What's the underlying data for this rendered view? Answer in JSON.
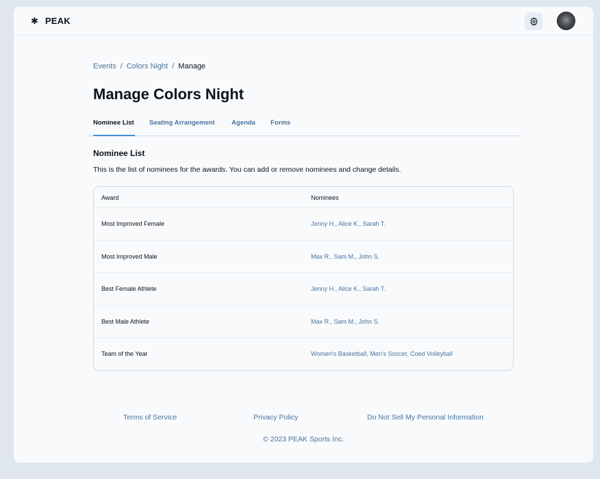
{
  "header": {
    "logo_icon": "✱",
    "brand": "PEAK",
    "settings_icon": "gear-icon",
    "avatar": "user-avatar"
  },
  "breadcrumb": {
    "items": [
      "Events",
      "Colors Night"
    ],
    "separator": "/",
    "current": "Manage"
  },
  "page": {
    "title": "Manage Colors Night"
  },
  "tabs": [
    {
      "label": "Nominee List",
      "active": true
    },
    {
      "label": "Seating Arrangement",
      "active": false
    },
    {
      "label": "Agenda",
      "active": false
    },
    {
      "label": "Forms",
      "active": false
    }
  ],
  "section": {
    "title": "Nominee List",
    "description": "This is the list of nominees for the awards. You can add or remove nominees and change details."
  },
  "table": {
    "columns": [
      "Award",
      "Nominees"
    ],
    "rows": [
      {
        "award": "Most Improved Female",
        "nominees": "Jenny H., Alice K., Sarah T."
      },
      {
        "award": "Most Improved Male",
        "nominees": "Max R., Sam M., John S."
      },
      {
        "award": "Best Female Athlete",
        "nominees": "Jenny H., Alice K., Sarah T."
      },
      {
        "award": "Best Male Athlete",
        "nominees": "Max R., Sam M., John S."
      },
      {
        "award": "Team of the Year",
        "nominees": "Women's Basketball, Men's Soccer, Coed Volleyball"
      }
    ]
  },
  "footer": {
    "links": [
      "Terms of Service",
      "Privacy Policy",
      "Do Not Sell My Personal Information"
    ],
    "copyright": "© 2023 PEAK Sports Inc."
  },
  "colors": {
    "accent": "#3d8fd8",
    "link": "#49739c",
    "text": "#0d141c",
    "background": "#f8fafc"
  }
}
